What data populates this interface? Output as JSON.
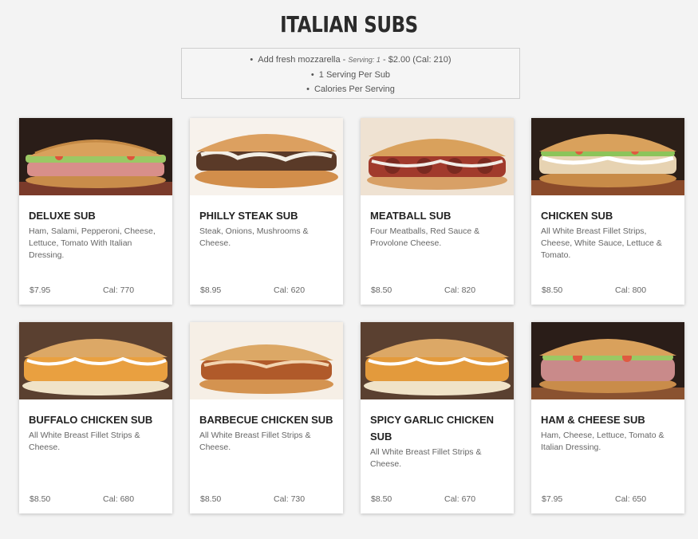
{
  "page": {
    "title": "ITALIAN SUBS"
  },
  "info": {
    "addon_prefix": "Add fresh mozzarella - ",
    "addon_serving": "Serving: 1",
    "addon_suffix": " - $2.00 (Cal: 210)",
    "servings": "1 Serving Per Sub",
    "calories_note": "Calories Per Serving"
  },
  "colors": {
    "background": "#f3f3f3",
    "card": "#ffffff",
    "bread": "#d9a15c",
    "dark_board": "#3a2a22"
  },
  "items": [
    {
      "name": "DELUXE SUB",
      "description": "Ham, Salami, Pepperoni, Cheese, Lettuce, Tomato With Italian Dressing.",
      "price": "$7.95",
      "calories": "Cal: 770",
      "image": "deluxe-sub-photo"
    },
    {
      "name": "PHILLY STEAK SUB",
      "description": "Steak, Onions, Mushrooms & Cheese.",
      "price": "$8.95",
      "calories": "Cal: 620",
      "image": "philly-steak-sub-photo"
    },
    {
      "name": "MEATBALL SUB",
      "description": "Four Meatballs, Red Sauce & Provolone Cheese.",
      "price": "$8.50",
      "calories": "Cal: 820",
      "image": "meatball-sub-photo"
    },
    {
      "name": "CHICKEN SUB",
      "description": "All White Breast Fillet Strips, Cheese, White Sauce, Lettuce & Tomato.",
      "price": "$8.50",
      "calories": "Cal: 800",
      "image": "chicken-sub-photo"
    },
    {
      "name": "BUFFALO CHICKEN SUB",
      "description": "All White Breast Fillet Strips & Cheese.",
      "price": "$8.50",
      "calories": "Cal: 680",
      "image": "buffalo-chicken-sub-photo"
    },
    {
      "name": "BARBECUE CHICKEN SUB",
      "description": "All White Breast Fillet Strips & Cheese.",
      "price": "$8.50",
      "calories": "Cal: 730",
      "image": "barbecue-chicken-sub-photo"
    },
    {
      "name": "SPICY GARLIC CHICKEN SUB",
      "description": "All White Breast Fillet Strips & Cheese.",
      "price": "$8.50",
      "calories": "Cal: 670",
      "image": "spicy-garlic-chicken-sub-photo"
    },
    {
      "name": "HAM & CHEESE SUB",
      "description": "Ham, Cheese, Lettuce, Tomato & Italian Dressing.",
      "price": "$7.95",
      "calories": "Cal: 650",
      "image": "ham-cheese-sub-photo"
    }
  ]
}
